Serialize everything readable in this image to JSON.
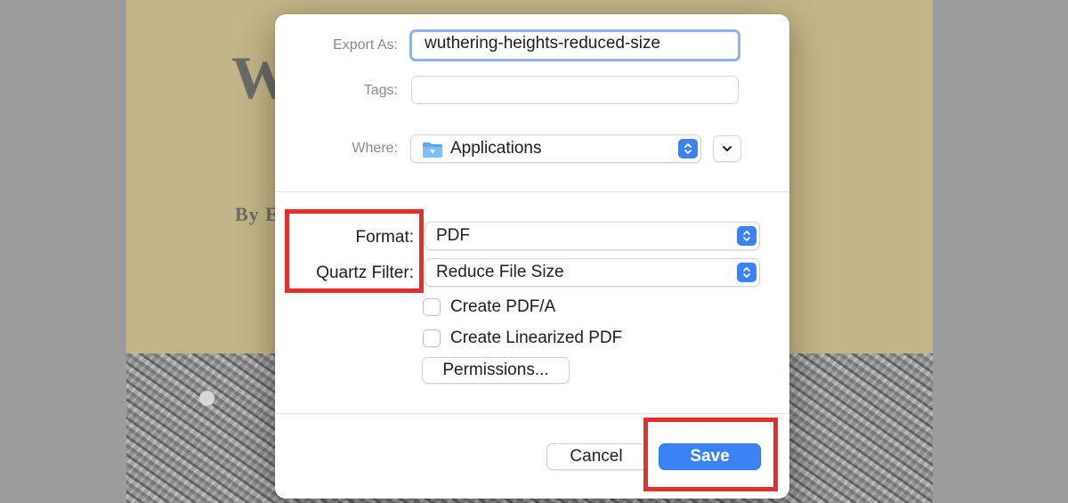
{
  "document": {
    "title_fragment": "W",
    "byline_fragment": "By E"
  },
  "dialog": {
    "export_as": {
      "label": "Export As:",
      "value": "wuthering-heights-reduced-size"
    },
    "tags": {
      "label": "Tags:",
      "value": ""
    },
    "where": {
      "label": "Where:",
      "value": "Applications",
      "icon": "folder-icon"
    },
    "format": {
      "label": "Format:",
      "value": "PDF"
    },
    "quartz_filter": {
      "label": "Quartz Filter:",
      "value": "Reduce File Size"
    },
    "options": [
      {
        "label": "Create PDF/A",
        "checked": false
      },
      {
        "label": "Create Linearized PDF",
        "checked": false
      }
    ],
    "permissions_label": "Permissions...",
    "cancel_label": "Cancel",
    "save_label": "Save"
  },
  "colors": {
    "accent": "#3a82f6",
    "highlight": "#e03030",
    "document_background": "#c3b587"
  }
}
